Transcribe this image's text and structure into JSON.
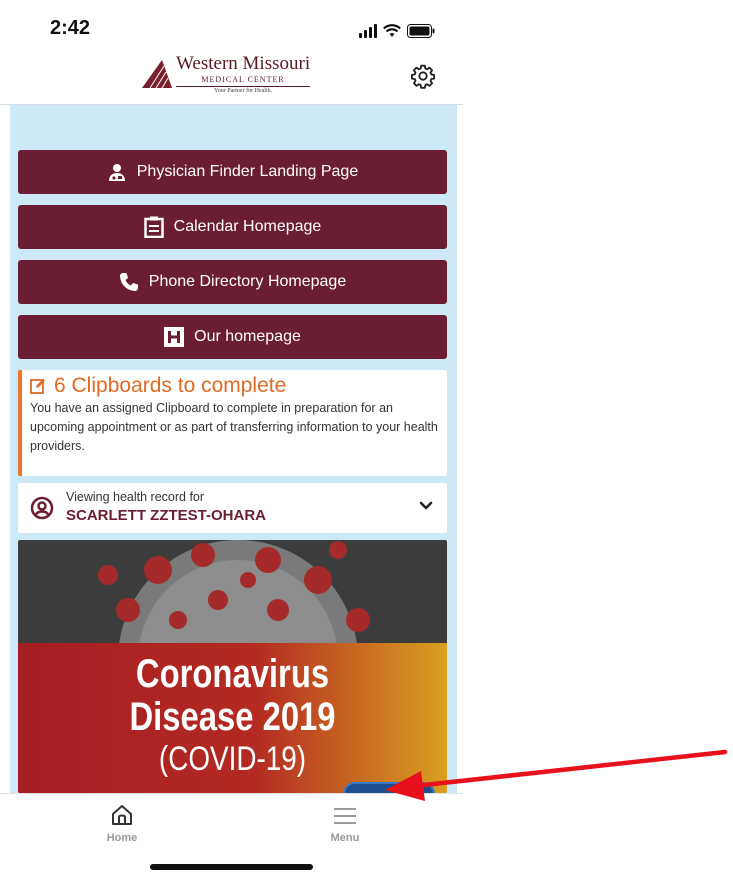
{
  "status_bar": {
    "time": "2:42"
  },
  "header": {
    "logo_title": "Western Missouri",
    "logo_subtitle": "MEDICAL CENTER",
    "logo_tagline": "Your Partner for Health.",
    "settings_icon": "gear-icon"
  },
  "nav_buttons": [
    {
      "label": "Physician Finder Landing Page",
      "icon": "physician-icon"
    },
    {
      "label": "Calendar Homepage",
      "icon": "clipboard-icon"
    },
    {
      "label": "Phone Directory Homepage",
      "icon": "phone-icon"
    },
    {
      "label": "Our homepage",
      "icon": "hospital-icon"
    }
  ],
  "clipboards": {
    "title": "6 Clipboards to complete",
    "body": "You have an assigned Clipboard to complete in preparation for an upcoming appointment or as part of transferring information to your health providers.",
    "accent": "#e8782f"
  },
  "health_record": {
    "label": "Viewing health record for",
    "name": "SCARLETT ZZTEST-OHARA"
  },
  "banner": {
    "line1": "Coronavirus",
    "line2": "Disease 2019",
    "line3": "(COVID-19)"
  },
  "tab_bar": {
    "home": "Home",
    "menu": "Menu"
  },
  "colors": {
    "button": "#6b1e33",
    "background": "#cde9f5",
    "annotation_arrow": "#e8111b"
  }
}
